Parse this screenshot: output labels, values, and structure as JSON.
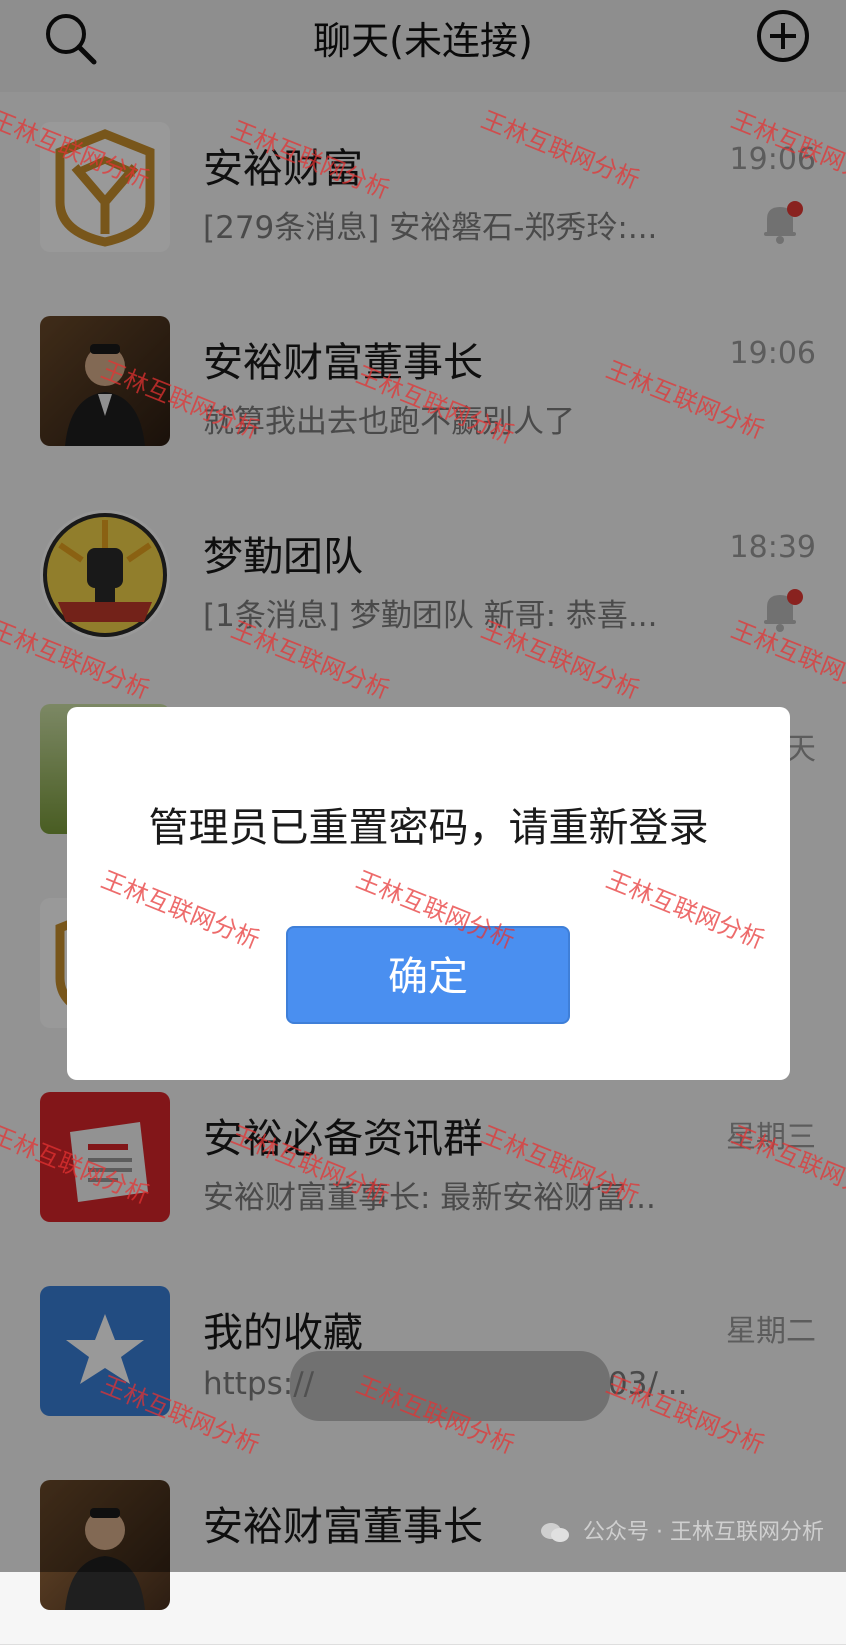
{
  "header": {
    "title": "聊天(未连接)"
  },
  "chats": [
    {
      "name": "安裕财富",
      "preview": "[279条消息] 安裕磐石-郑秀玲:...",
      "time": "19:06",
      "muted": true
    },
    {
      "name": "安裕财富董事长",
      "preview": "就算我出去也跑不赢别人了",
      "time": "19:06",
      "muted": false
    },
    {
      "name": "梦勤团队",
      "preview": "[1条消息] 梦勤团队 新哥: 恭喜...",
      "time": "18:39",
      "muted": true
    },
    {
      "name": "",
      "preview": "",
      "time": "天",
      "muted": false
    },
    {
      "name": "",
      "preview": "",
      "time": "",
      "muted": false
    },
    {
      "name": "安裕必备资讯群",
      "preview": "安裕财富董事长: 最新安裕财富...",
      "time": "星期三",
      "muted": false
    },
    {
      "name": "我的收藏",
      "preview": "https://",
      "preview_tail": "03/...",
      "time": "星期二",
      "muted": false
    },
    {
      "name": "安裕财富董事长",
      "preview": "",
      "time": "",
      "muted": false
    }
  ],
  "dialog": {
    "message": "管理员已重置密码，请重新登录",
    "confirm_label": "确定"
  },
  "watermark": "王林互联网分析",
  "footer_credit": "公众号 · 王林互联网分析",
  "colors": {
    "accent": "#4a8ff0",
    "watermark": "#e63232",
    "mute_dot": "#e53935"
  }
}
